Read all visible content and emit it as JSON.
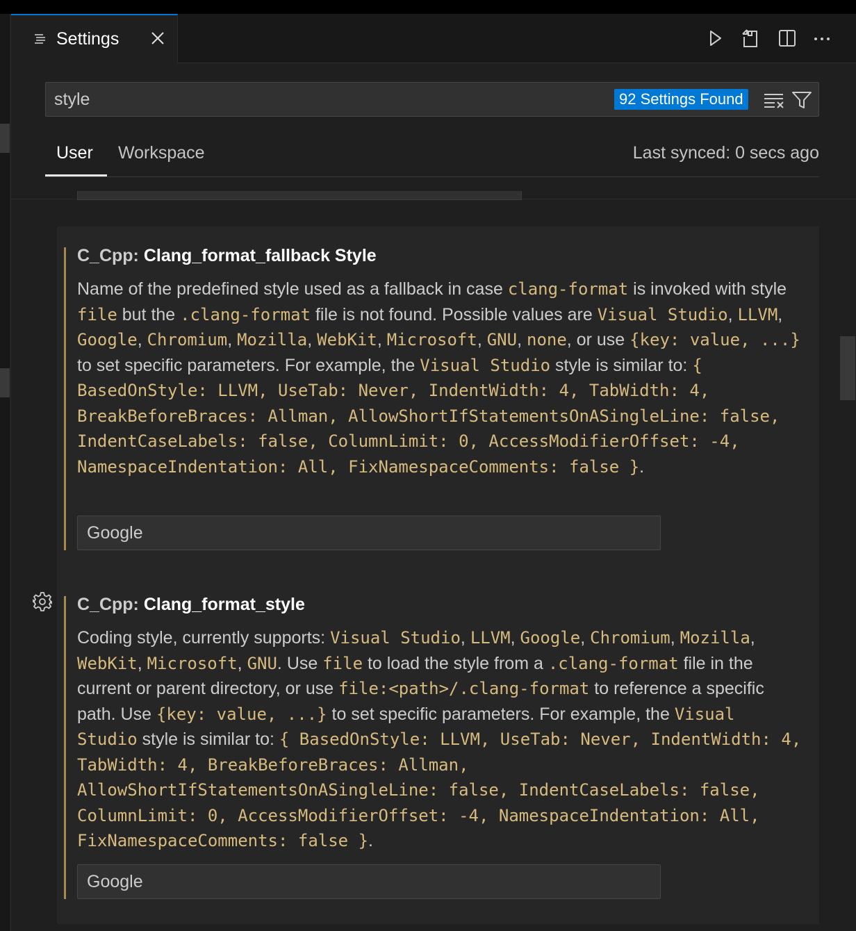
{
  "tab": {
    "title": "Settings"
  },
  "search": {
    "value": "style",
    "results_badge": "92 Settings Found"
  },
  "scopes": {
    "user": "User",
    "workspace": "Workspace",
    "last_synced": "Last synced: 0 secs ago"
  },
  "settings": [
    {
      "category": "C_Cpp: ",
      "name": "Clang_format_fallback Style",
      "description_runs": [
        {
          "t": "Name of the predefined style used as a fallback in case "
        },
        {
          "t": "clang-format",
          "code": true
        },
        {
          "t": " is invoked with style "
        },
        {
          "t": "file",
          "code": true
        },
        {
          "t": " but the "
        },
        {
          "t": ".clang-format",
          "code": true
        },
        {
          "t": " file is not found. Possible values are "
        },
        {
          "t": "Visual Studio",
          "code": true
        },
        {
          "t": ", "
        },
        {
          "t": "LLVM",
          "code": true
        },
        {
          "t": ", "
        },
        {
          "t": "Google",
          "code": true
        },
        {
          "t": ", "
        },
        {
          "t": "Chromium",
          "code": true
        },
        {
          "t": ", "
        },
        {
          "t": "Mozilla",
          "code": true
        },
        {
          "t": ", "
        },
        {
          "t": "WebKit",
          "code": true
        },
        {
          "t": ", "
        },
        {
          "t": "Microsoft",
          "code": true
        },
        {
          "t": ", "
        },
        {
          "t": "GNU",
          "code": true
        },
        {
          "t": ", "
        },
        {
          "t": "none",
          "code": true
        },
        {
          "t": ", or use "
        },
        {
          "t": "{key: value, ...}",
          "code": true
        },
        {
          "t": " to set specific parameters. For example, the "
        },
        {
          "t": "Visual Studio",
          "code": true
        },
        {
          "t": " style is similar to: "
        },
        {
          "t": "{ BasedOnStyle: LLVM, UseTab: Never, IndentWidth: 4, TabWidth: 4, BreakBeforeBraces: Allman, AllowShortIfStatementsOnASingleLine: false, IndentCaseLabels: false, ColumnLimit: 0, AccessModifierOffset: -4, NamespaceIndentation: All, FixNamespaceComments: false }",
          "code": true
        },
        {
          "t": "."
        }
      ],
      "value": "Google"
    },
    {
      "category": "C_Cpp: ",
      "name": "Clang_format_style",
      "description_runs": [
        {
          "t": "Coding style, currently supports: "
        },
        {
          "t": "Visual Studio",
          "code": true
        },
        {
          "t": ", "
        },
        {
          "t": "LLVM",
          "code": true
        },
        {
          "t": ", "
        },
        {
          "t": "Google",
          "code": true
        },
        {
          "t": ", "
        },
        {
          "t": "Chromium",
          "code": true
        },
        {
          "t": ", "
        },
        {
          "t": "Mozilla",
          "code": true
        },
        {
          "t": ", "
        },
        {
          "t": "WebKit",
          "code": true
        },
        {
          "t": ", "
        },
        {
          "t": "Microsoft",
          "code": true
        },
        {
          "t": ", "
        },
        {
          "t": "GNU",
          "code": true
        },
        {
          "t": ". Use "
        },
        {
          "t": "file",
          "code": true
        },
        {
          "t": " to load the style from a "
        },
        {
          "t": ".clang-format",
          "code": true
        },
        {
          "t": " file in the current or parent directory, or use "
        },
        {
          "t": "file:<path>/.clang-format",
          "code": true
        },
        {
          "t": " to reference a specific path. Use "
        },
        {
          "t": "{key: value, ...}",
          "code": true
        },
        {
          "t": " to set specific parameters. For example, the "
        },
        {
          "t": "Visual Studio",
          "code": true
        },
        {
          "t": " style is similar to: "
        },
        {
          "t": "{ BasedOnStyle: LLVM, UseTab: Never, IndentWidth: 4, TabWidth: 4, BreakBeforeBraces: Allman, AllowShortIfStatementsOnASingleLine: false, IndentCaseLabels: false, ColumnLimit: 0, AccessModifierOffset: -4, NamespaceIndentation: All, FixNamespaceComments: false }",
          "code": true
        },
        {
          "t": "."
        }
      ],
      "value": "Google"
    }
  ],
  "icons": {
    "tab": "settings-list-icon",
    "close": "close-icon",
    "run": "run-icon",
    "open_json": "open-settings-json-icon",
    "split": "split-editor-icon",
    "more": "more-actions-icon",
    "clear": "clear-filter-icon",
    "filter": "filter-icon",
    "gear": "gear-icon"
  },
  "colors": {
    "accent": "#0078d4",
    "code": "#d7ba7d",
    "modified_bar": "#a88b4a"
  }
}
